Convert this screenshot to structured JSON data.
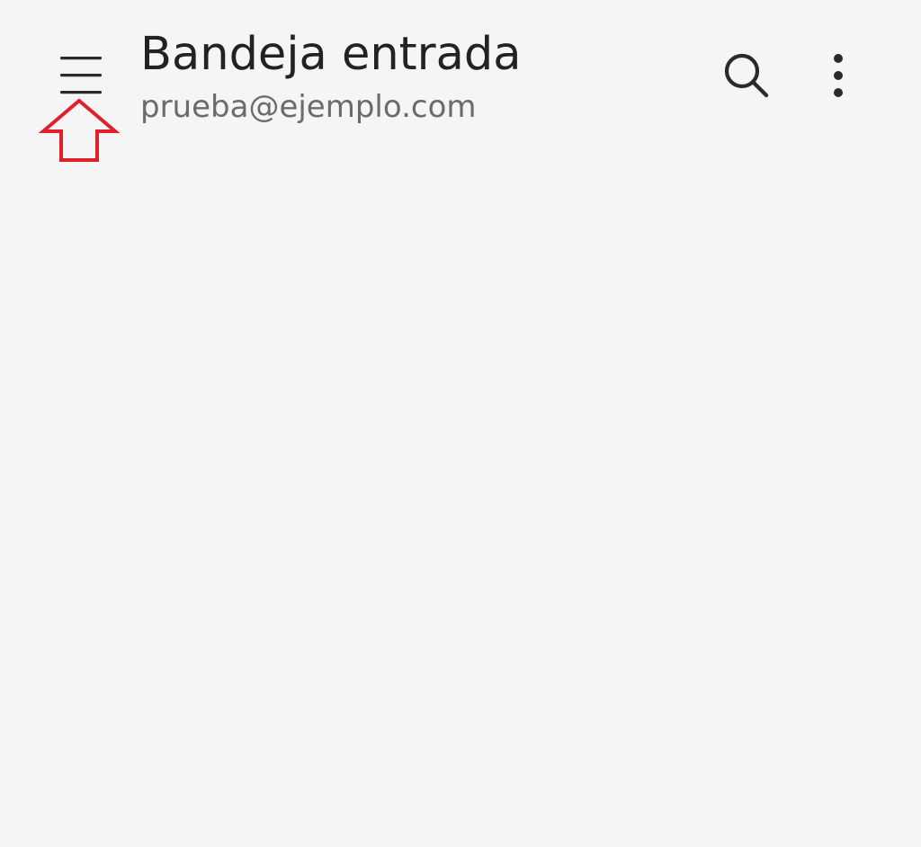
{
  "app_bar": {
    "title": "Bandeja entrada",
    "account_email": "prueba@ejemplo.com",
    "menu_icon": "hamburger-menu-icon",
    "search_icon": "search-icon",
    "overflow_icon": "more-vertical-icon"
  },
  "annotation": {
    "icon": "up-arrow-outline-icon",
    "color": "#e0202a"
  },
  "colors": {
    "background": "#f5f5f5",
    "title_text": "#222222",
    "subtitle_text": "#6b6b6b"
  }
}
